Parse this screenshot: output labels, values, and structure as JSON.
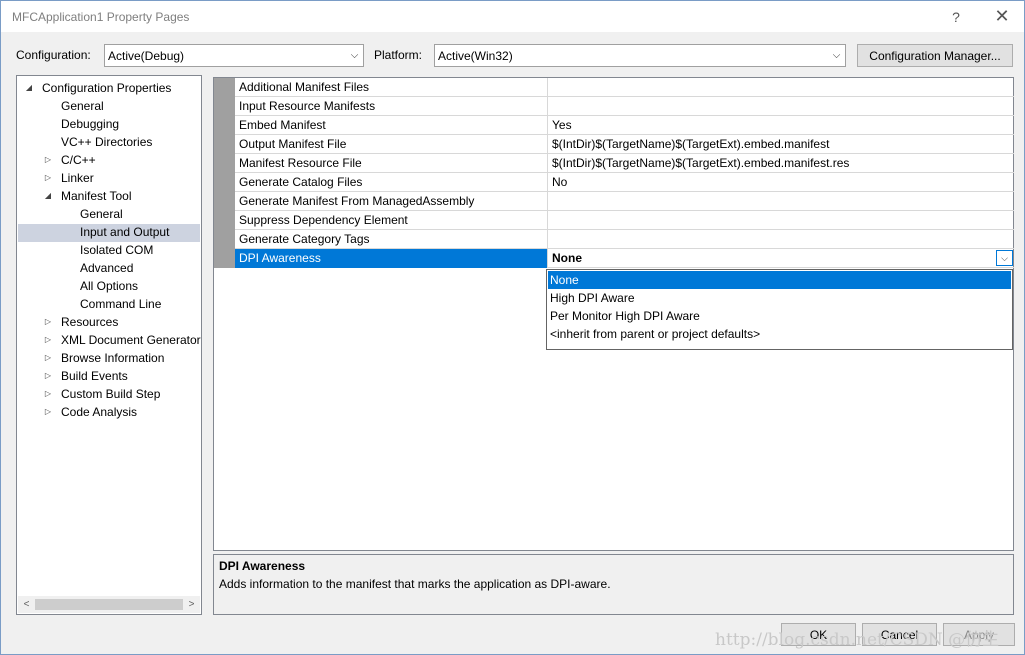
{
  "window": {
    "title": "MFCApplication1 Property Pages",
    "help_label": "?",
    "close_label": "✕"
  },
  "config": {
    "configuration_label": "Configuration:",
    "configuration_value": "Active(Debug)",
    "platform_label": "Platform:",
    "platform_value": "Active(Win32)",
    "manager_button": "Configuration Manager..."
  },
  "tree": {
    "items": [
      {
        "label": "Configuration Properties",
        "expander": "expanded"
      },
      {
        "label": "General",
        "expander": "none"
      },
      {
        "label": "Debugging",
        "expander": "none"
      },
      {
        "label": "VC++ Directories",
        "expander": "none"
      },
      {
        "label": "C/C++",
        "expander": "collapsed"
      },
      {
        "label": "Linker",
        "expander": "collapsed"
      },
      {
        "label": "Manifest Tool",
        "expander": "expanded"
      },
      {
        "label": "General",
        "expander": "none"
      },
      {
        "label": "Input and Output",
        "expander": "none",
        "selected": true
      },
      {
        "label": "Isolated COM",
        "expander": "none"
      },
      {
        "label": "Advanced",
        "expander": "none"
      },
      {
        "label": "All Options",
        "expander": "none"
      },
      {
        "label": "Command Line",
        "expander": "none"
      },
      {
        "label": "Resources",
        "expander": "collapsed"
      },
      {
        "label": "XML Document Generator",
        "expander": "collapsed"
      },
      {
        "label": "Browse Information",
        "expander": "collapsed"
      },
      {
        "label": "Build Events",
        "expander": "collapsed"
      },
      {
        "label": "Custom Build Step",
        "expander": "collapsed"
      },
      {
        "label": "Code Analysis",
        "expander": "collapsed"
      }
    ],
    "scroll_left": "<",
    "scroll_right": ">"
  },
  "grid": {
    "rows": [
      {
        "name": "Additional Manifest Files",
        "value": ""
      },
      {
        "name": "Input Resource Manifests",
        "value": ""
      },
      {
        "name": "Embed Manifest",
        "value": "Yes"
      },
      {
        "name": "Output Manifest File",
        "value": "$(IntDir)$(TargetName)$(TargetExt).embed.manifest"
      },
      {
        "name": "Manifest Resource File",
        "value": "$(IntDir)$(TargetName)$(TargetExt).embed.manifest.res"
      },
      {
        "name": "Generate Catalog Files",
        "value": "No"
      },
      {
        "name": "Generate Manifest From ManagedAssembly",
        "value": ""
      },
      {
        "name": "Suppress Dependency Element",
        "value": ""
      },
      {
        "name": "Generate Category Tags",
        "value": ""
      },
      {
        "name": "DPI Awareness",
        "value": "None",
        "active": true
      }
    ]
  },
  "dropdown": {
    "options": [
      {
        "label": "None",
        "selected": true
      },
      {
        "label": "High DPI Aware"
      },
      {
        "label": "Per Monitor High DPI Aware"
      },
      {
        "label": "<inherit from parent or project defaults>"
      }
    ]
  },
  "description": {
    "title": "DPI Awareness",
    "text": "Adds information to the manifest that marks the application as DPI-aware."
  },
  "footer": {
    "ok_label": "OK",
    "cancel_label": "Cancel",
    "apply_label": "Apply"
  },
  "watermark": "http://blog.csdn.net/CSDN @仿生"
}
